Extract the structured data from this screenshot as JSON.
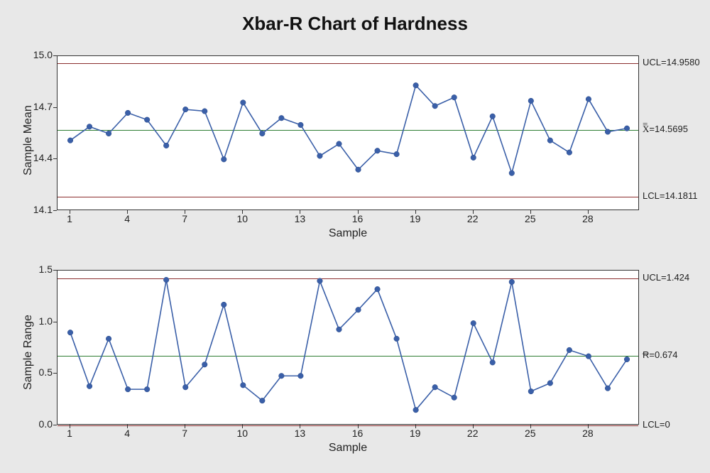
{
  "title": "Xbar-R Chart of Hardness",
  "chart_data": [
    {
      "type": "line",
      "name": "xbar",
      "title": "Xbar Chart",
      "ylabel": "Sample Mean",
      "xlabel": "Sample",
      "ylim": [
        14.1,
        15.0
      ],
      "xlim": [
        1,
        30
      ],
      "y_ticks": [
        14.1,
        14.4,
        14.7,
        15.0
      ],
      "x_ticks": [
        1,
        4,
        7,
        10,
        13,
        16,
        19,
        22,
        25,
        28
      ],
      "ucl": 14.958,
      "center": 14.5695,
      "lcl": 14.1811,
      "center_symbol": "X̿",
      "series": [
        {
          "name": "Sample Mean",
          "x": [
            1,
            2,
            3,
            4,
            5,
            6,
            7,
            8,
            9,
            10,
            11,
            12,
            13,
            14,
            15,
            16,
            17,
            18,
            19,
            20,
            21,
            22,
            23,
            24,
            25,
            26,
            27,
            28,
            29,
            30
          ],
          "values": [
            14.51,
            14.59,
            14.55,
            14.67,
            14.63,
            14.48,
            14.69,
            14.68,
            14.4,
            14.73,
            14.55,
            14.64,
            14.6,
            14.42,
            14.49,
            14.34,
            14.45,
            14.43,
            14.83,
            14.71,
            14.76,
            14.41,
            14.65,
            14.32,
            14.74,
            14.51,
            14.44,
            14.75,
            14.56,
            14.58
          ]
        }
      ]
    },
    {
      "type": "line",
      "name": "range",
      "title": "R Chart",
      "ylabel": "Sample Range",
      "xlabel": "Sample",
      "ylim": [
        0.0,
        1.5
      ],
      "xlim": [
        1,
        30
      ],
      "y_ticks": [
        0.0,
        0.5,
        1.0,
        1.5
      ],
      "x_ticks": [
        1,
        4,
        7,
        10,
        13,
        16,
        19,
        22,
        25,
        28
      ],
      "ucl": 1.424,
      "center": 0.674,
      "lcl": 0,
      "center_symbol": "R̄",
      "series": [
        {
          "name": "Sample Range",
          "x": [
            1,
            2,
            3,
            4,
            5,
            6,
            7,
            8,
            9,
            10,
            11,
            12,
            13,
            14,
            15,
            16,
            17,
            18,
            19,
            20,
            21,
            22,
            23,
            24,
            25,
            26,
            27,
            28,
            29,
            30
          ],
          "values": [
            0.9,
            0.38,
            0.84,
            0.35,
            0.35,
            1.41,
            0.37,
            0.59,
            1.17,
            0.39,
            0.24,
            0.48,
            0.48,
            1.4,
            0.93,
            1.12,
            1.32,
            0.84,
            0.15,
            0.37,
            0.27,
            0.99,
            0.61,
            1.39,
            0.33,
            0.41,
            0.73,
            0.67,
            0.36,
            0.64
          ]
        }
      ]
    }
  ],
  "ref_labels": {
    "ucl_prefix": "UCL=",
    "lcl_prefix": "LCL=",
    "xbar_ucl": "14.9580",
    "xbar_center": "14.5695",
    "xbar_lcl": "14.1811",
    "range_ucl": "1.424",
    "range_center": "0.674",
    "range_lcl": "0"
  }
}
